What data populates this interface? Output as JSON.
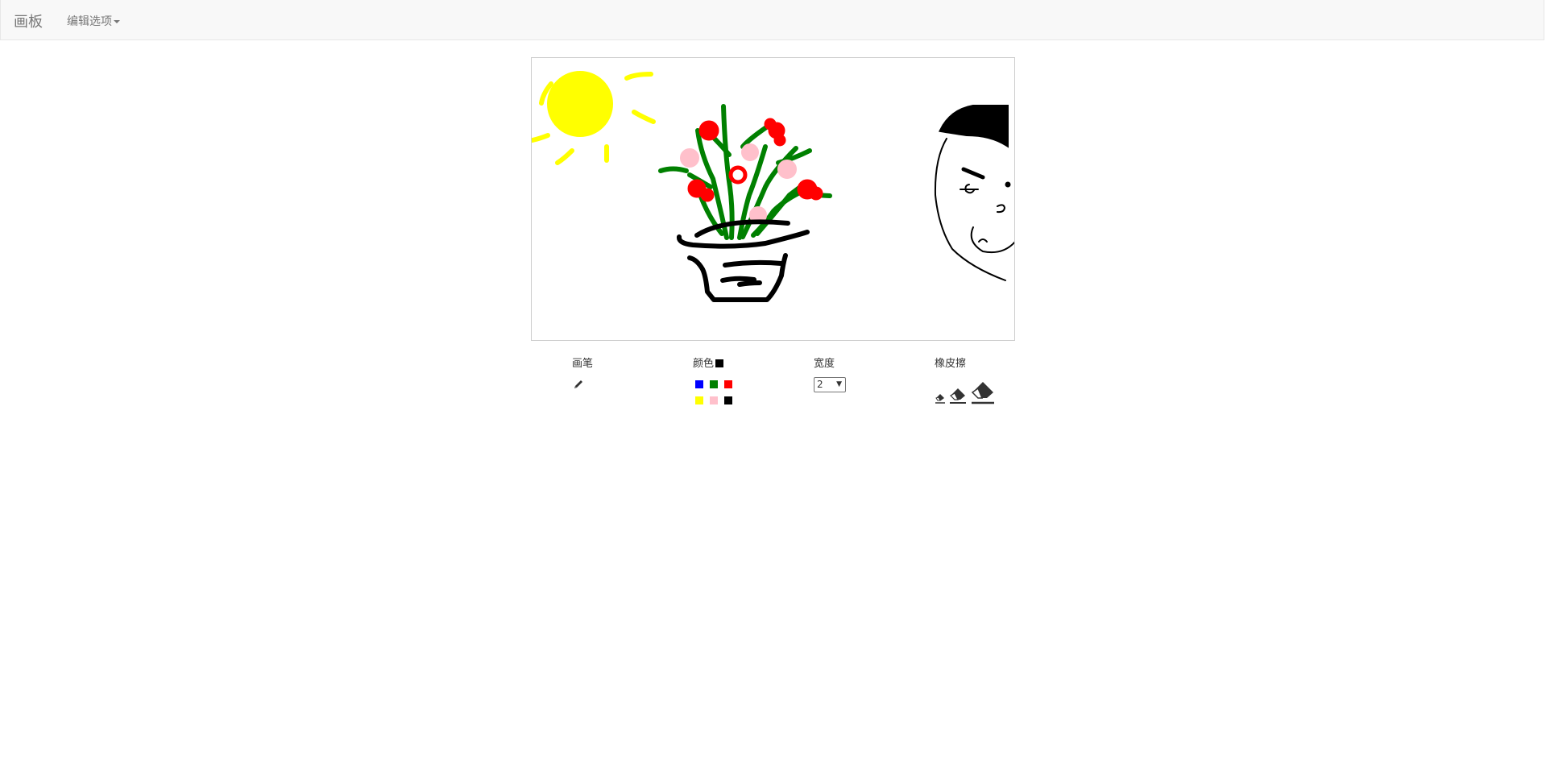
{
  "navbar": {
    "brand": "画板",
    "menu_label": "编辑选项"
  },
  "toolbar": {
    "pen": {
      "label": "画笔",
      "icon": "pencil-icon"
    },
    "color": {
      "label": "颜色",
      "current": "#000000",
      "swatches": [
        "#0000ff",
        "#008000",
        "#ff0000",
        "#ffff00",
        "#ffc0cb",
        "#000000"
      ]
    },
    "width": {
      "label": "宽度",
      "value": "2",
      "arrow": "▼"
    },
    "eraser": {
      "label": "橡皮擦",
      "sizes": [
        "small",
        "medium",
        "large"
      ]
    }
  }
}
